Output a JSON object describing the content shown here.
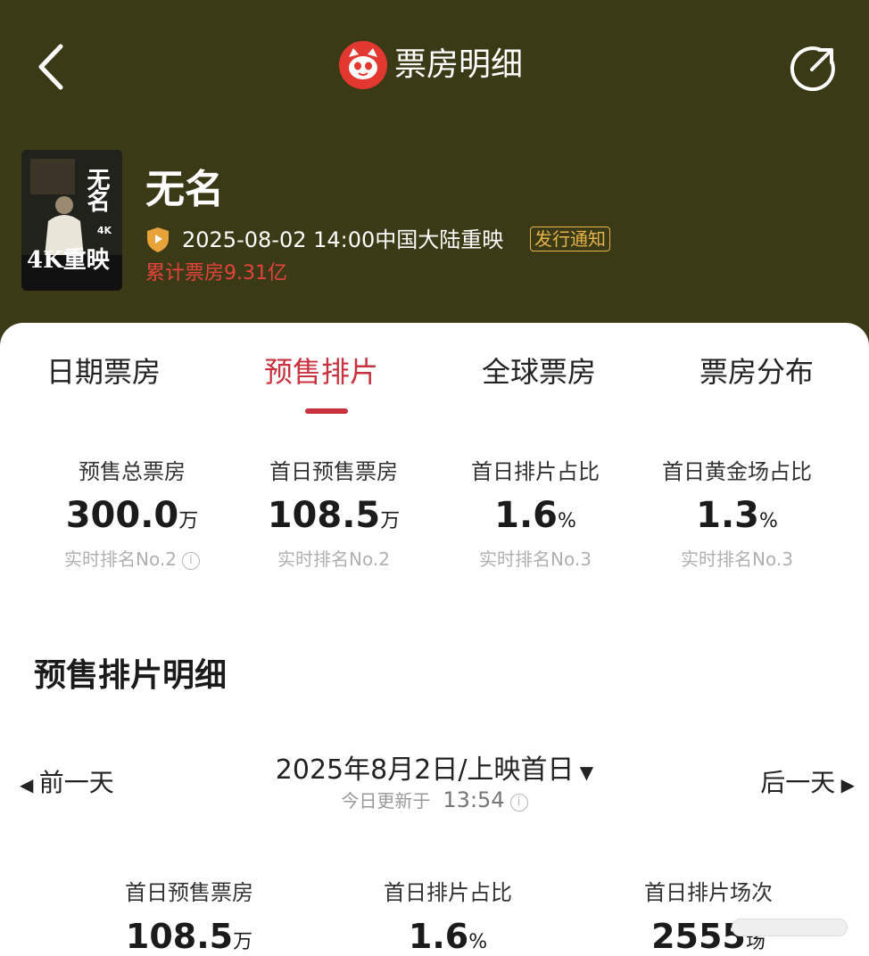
{
  "header": {
    "title": "票房明细"
  },
  "movie": {
    "poster_title": "无名",
    "poster_tag": "4K",
    "poster_caption": "4K重映",
    "title": "无名",
    "release": "2025-08-02 14:00中国大陆重映",
    "notice_label": "发行通知",
    "total_box_office": "累计票房9.31亿"
  },
  "tabs": [
    {
      "label": "日期票房"
    },
    {
      "label": "预售排片"
    },
    {
      "label": "全球票房"
    },
    {
      "label": "票房分布"
    }
  ],
  "active_tab": "预售排片",
  "stats": [
    {
      "label": "预售总票房",
      "value": "300.0",
      "unit": "万",
      "rank": "实时排名No.2"
    },
    {
      "label": "首日预售票房",
      "value": "108.5",
      "unit": "万",
      "rank": "实时排名No.2"
    },
    {
      "label": "首日排片占比",
      "value": "1.6",
      "unit": "%",
      "rank": "实时排名No.3"
    },
    {
      "label": "首日黄金场占比",
      "value": "1.3",
      "unit": "%",
      "rank": "实时排名No.3"
    }
  ],
  "detail": {
    "title": "预售排片明细",
    "prev_label": "前一天",
    "next_label": "后一天",
    "date_label": "2025年8月2日/上映首日",
    "updated_prefix": "今日更新于",
    "updated_time": "13:54"
  },
  "bottom_stats": [
    {
      "label": "首日预售票房",
      "value": "108.5",
      "unit": "万"
    },
    {
      "label": "首日排片占比",
      "value": "1.6",
      "unit": "%"
    },
    {
      "label": "首日排片场次",
      "value": "2555",
      "unit": "场"
    }
  ],
  "colors": {
    "header_bg": "#3a3a16",
    "accent": "#c8323f",
    "gold": "#e8b44a",
    "total_red": "#e6433e"
  }
}
